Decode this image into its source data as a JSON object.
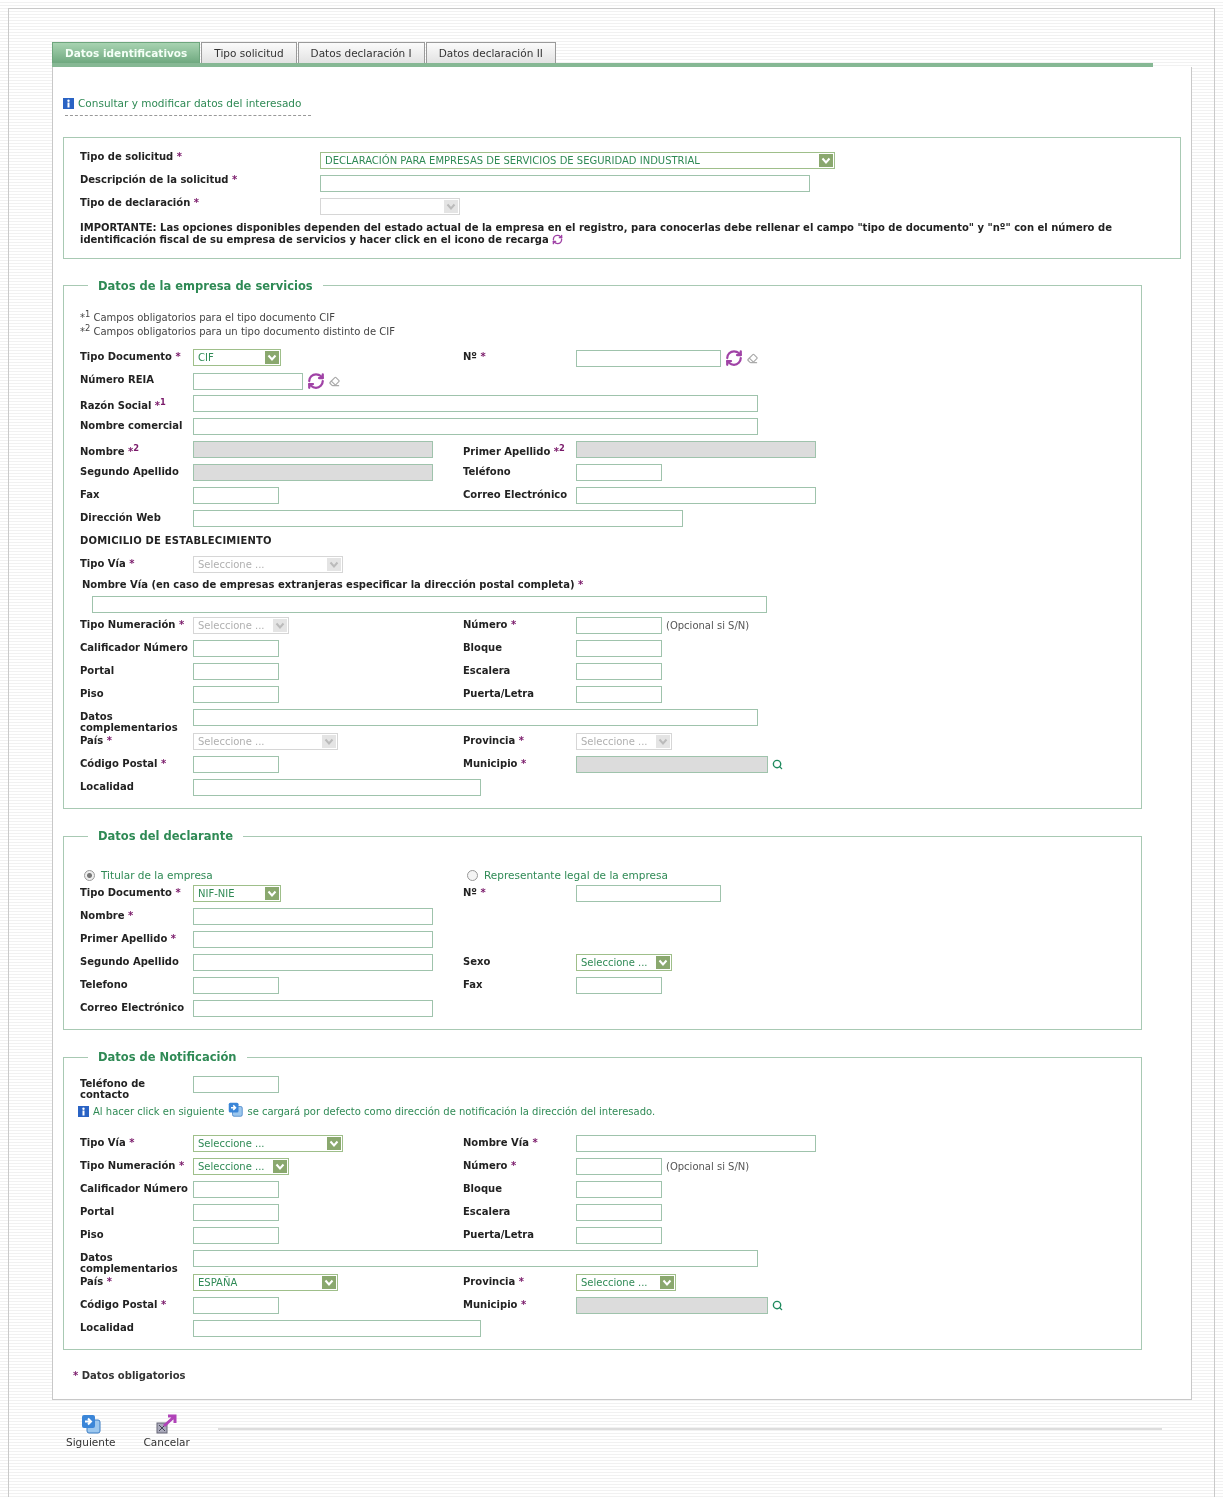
{
  "tabs": [
    {
      "label": "Datos identificativos",
      "selected": true
    },
    {
      "label": "Tipo solicitud",
      "selected": false
    },
    {
      "label": "Datos declaración I",
      "selected": false
    },
    {
      "label": "Datos declaración II",
      "selected": false
    }
  ],
  "info_link": "Consultar y modificar datos del interesado",
  "request": {
    "fields": [
      {
        "label": "Tipo de solicitud",
        "mark": "*",
        "control": {
          "kind": "select",
          "value": "DECLARACIÓN PARA EMPRESAS DE SERVICIOS DE SEGURIDAD INDUSTRIAL",
          "disabled": false
        }
      },
      {
        "label": "Descripción de la solicitud",
        "mark": "*",
        "control": {
          "kind": "text"
        }
      },
      {
        "label": "Tipo de declaración",
        "mark": "*",
        "control": {
          "kind": "select",
          "disabled": true
        }
      }
    ],
    "note": "IMPORTANTE: Las opciones disponibles dependen del estado actual de la empresa en el registro, para conocerlas debe rellenar el campo \"tipo de documento\" y \"nº\" con el número de identificación fiscal de su empresa de servicios y hacer click en el icono de recarga"
  },
  "sections": [
    {
      "title": "Datos de la empresa de servicios",
      "notes": [
        "*$^{1}$ Campos obligatorios para el tipo documento CIF",
        "*$^{2}$ Campos obligatorios para un tipo documento distinto de CIF"
      ],
      "rows": [
        {
          "kind": "pair",
          "left": {
            "label": "Tipo Documento",
            "mark": "*",
            "control": {
              "kind": "select",
              "value": "CIF",
              "disabled": false
            }
          },
          "right": {
            "label": "Nº",
            "mark": "*",
            "control": {
              "kind": "text"
            },
            "extras": [
              {
                "kind": "refresh"
              },
              {
                "kind": "eraser"
              }
            ]
          }
        },
        {
          "kind": "pair",
          "left": {
            "label": "Número REIA",
            "control": {
              "kind": "text"
            },
            "extras": [
              {
                "kind": "refresh"
              },
              {
                "kind": "eraser"
              }
            ]
          }
        },
        {
          "kind": "pair",
          "left": {
            "label": "Razón Social",
            "mark": "*$^{1}$",
            "control": {
              "kind": "text"
            }
          }
        },
        {
          "kind": "pair",
          "left": {
            "label": "Nombre comercial",
            "control": {
              "kind": "text"
            }
          }
        },
        {
          "kind": "pair",
          "left": {
            "label": "Nombre",
            "mark": "*$^{2}$",
            "control": {
              "kind": "readonly"
            }
          },
          "right": {
            "label": "Primer Apellido",
            "mark": "*$^{2}$",
            "control": {
              "kind": "readonly"
            }
          }
        },
        {
          "kind": "pair",
          "left": {
            "label": "Segundo Apellido",
            "control": {
              "kind": "readonly"
            }
          },
          "right": {
            "label": "Teléfono",
            "control": {
              "kind": "text"
            }
          }
        },
        {
          "kind": "pair",
          "left": {
            "label": "Fax",
            "control": {
              "kind": "text"
            }
          },
          "right": {
            "label": "Correo Electrónico",
            "control": {
              "kind": "text"
            }
          }
        },
        {
          "kind": "pair",
          "left": {
            "label": "Dirección Web",
            "control": {
              "kind": "text"
            }
          }
        },
        {
          "kind": "heading",
          "text": "DOMICILIO DE ESTABLECIMIENTO"
        },
        {
          "kind": "pair",
          "left": {
            "label": "Tipo Vía",
            "mark": "*",
            "control": {
              "kind": "select",
              "value": "Seleccione ...",
              "disabled": true
            }
          }
        },
        {
          "kind": "wide_label",
          "label": "Nombre Vía (en caso de empresas extranjeras especificar la dirección postal completa)",
          "mark": "*"
        },
        {
          "kind": "wide_input",
          "control": {
            "kind": "text"
          }
        },
        {
          "kind": "pair",
          "left": {
            "label": "Tipo Numeración",
            "mark": "*",
            "control": {
              "kind": "select",
              "value": "Seleccione ...",
              "disabled": true
            }
          },
          "right": {
            "label": "Número",
            "mark": "*",
            "control": {
              "kind": "text"
            },
            "extras": [
              {
                "kind": "hint",
                "text": "(Opcional si S/N)"
              }
            ]
          }
        },
        {
          "kind": "pair",
          "left": {
            "label": "Calificador Número",
            "control": {
              "kind": "text"
            }
          },
          "right": {
            "label": "Bloque",
            "control": {
              "kind": "text"
            }
          }
        },
        {
          "kind": "pair",
          "left": {
            "label": "Portal",
            "control": {
              "kind": "text"
            }
          },
          "right": {
            "label": "Escalera",
            "control": {
              "kind": "text"
            }
          }
        },
        {
          "kind": "pair",
          "left": {
            "label": "Piso",
            "control": {
              "kind": "text"
            }
          },
          "right": {
            "label": "Puerta/Letra",
            "control": {
              "kind": "text"
            }
          }
        },
        {
          "kind": "pair",
          "left": {
            "label": "Datos complementarios",
            "control": {
              "kind": "text"
            }
          }
        },
        {
          "kind": "pair",
          "left": {
            "label": "País",
            "mark": "*",
            "control": {
              "kind": "select",
              "value": "Seleccione ...",
              "disabled": true
            }
          },
          "right": {
            "label": "Provincia",
            "mark": "*",
            "control": {
              "kind": "select",
              "value": "Seleccione ...",
              "disabled": true
            }
          }
        },
        {
          "kind": "pair",
          "left": {
            "label": "Código Postal",
            "mark": "*",
            "control": {
              "kind": "text"
            }
          },
          "right": {
            "label": "Municipio",
            "mark": "*",
            "control": {
              "kind": "readonly"
            },
            "extras": [
              {
                "kind": "search"
              }
            ]
          }
        },
        {
          "kind": "pair",
          "left": {
            "label": "Localidad",
            "control": {
              "kind": "text"
            }
          }
        }
      ]
    },
    {
      "title": "Datos del declarante",
      "rows": [
        {
          "kind": "radios",
          "options": [
            {
              "label": "Titular de la empresa",
              "selected": true
            },
            {
              "label": "Representante legal de la empresa",
              "selected": false
            }
          ]
        },
        {
          "kind": "pair",
          "left": {
            "label": "Tipo Documento",
            "mark": "*",
            "control": {
              "kind": "select",
              "value": "NIF-NIE",
              "disabled": false
            }
          },
          "right": {
            "label": "Nº",
            "mark": "*",
            "control": {
              "kind": "text"
            }
          }
        },
        {
          "kind": "pair",
          "left": {
            "label": "Nombre",
            "mark": "*",
            "control": {
              "kind": "text"
            }
          }
        },
        {
          "kind": "pair",
          "left": {
            "label": "Primer Apellido",
            "mark": "*",
            "control": {
              "kind": "text"
            }
          }
        },
        {
          "kind": "pair",
          "left": {
            "label": "Segundo Apellido",
            "control": {
              "kind": "text"
            }
          },
          "right": {
            "label": "Sexo",
            "control": {
              "kind": "select",
              "value": "Seleccione ...",
              "disabled": false
            }
          }
        },
        {
          "kind": "pair",
          "left": {
            "label": "Telefono",
            "control": {
              "kind": "text"
            }
          },
          "right": {
            "label": "Fax",
            "control": {
              "kind": "text"
            }
          }
        },
        {
          "kind": "pair",
          "left": {
            "label": "Correo Electrónico",
            "control": {
              "kind": "text"
            }
          }
        }
      ]
    },
    {
      "title": "Datos de Notificación",
      "rows": [
        {
          "kind": "pair",
          "left": {
            "label": "Teléfono de contacto",
            "control": {
              "kind": "text"
            }
          }
        },
        {
          "kind": "info",
          "before": "Al hacer click en siguiente",
          "after": "se cargará por defecto como dirección de notificación la dirección del interesado."
        },
        {
          "kind": "pair",
          "left": {
            "label": "Tipo Vía",
            "mark": "*",
            "control": {
              "kind": "select",
              "value": "Seleccione ...",
              "disabled": false
            }
          },
          "right": {
            "label": "Nombre Vía",
            "mark": "*",
            "control": {
              "kind": "text"
            }
          }
        },
        {
          "kind": "pair",
          "left": {
            "label": "Tipo Numeración",
            "mark": "*",
            "control": {
              "kind": "select",
              "value": "Seleccione ...",
              "disabled": false
            }
          },
          "right": {
            "label": "Número",
            "mark": "*",
            "control": {
              "kind": "text"
            },
            "extras": [
              {
                "kind": "hint",
                "text": "(Opcional si S/N)"
              }
            ]
          }
        },
        {
          "kind": "pair",
          "left": {
            "label": "Calificador Número",
            "control": {
              "kind": "text"
            }
          },
          "right": {
            "label": "Bloque",
            "control": {
              "kind": "text"
            }
          }
        },
        {
          "kind": "pair",
          "left": {
            "label": "Portal",
            "control": {
              "kind": "text"
            }
          },
          "right": {
            "label": "Escalera",
            "control": {
              "kind": "text"
            }
          }
        },
        {
          "kind": "pair",
          "left": {
            "label": "Piso",
            "control": {
              "kind": "text"
            }
          },
          "right": {
            "label": "Puerta/Letra",
            "control": {
              "kind": "text"
            }
          }
        },
        {
          "kind": "pair",
          "left": {
            "label": "Datos complementarios",
            "control": {
              "kind": "text"
            }
          }
        },
        {
          "kind": "pair",
          "left": {
            "label": "País",
            "mark": "*",
            "control": {
              "kind": "select",
              "value": "ESPAÑA",
              "disabled": false
            }
          },
          "right": {
            "label": "Provincia",
            "mark": "*",
            "control": {
              "kind": "select",
              "value": "Seleccione ...",
              "disabled": false
            }
          }
        },
        {
          "kind": "pair",
          "left": {
            "label": "Código Postal",
            "mark": "*",
            "control": {
              "kind": "text"
            }
          },
          "right": {
            "label": "Municipio",
            "mark": "*",
            "control": {
              "kind": "readonly"
            },
            "extras": [
              {
                "kind": "search"
              }
            ]
          }
        },
        {
          "kind": "pair",
          "left": {
            "label": "Localidad",
            "control": {
              "kind": "text"
            }
          }
        }
      ]
    }
  ],
  "required_legend": {
    "mark": "*",
    "text": "Datos obligatorios"
  },
  "actions": [
    {
      "kind": "next",
      "label": "Siguiente"
    },
    {
      "kind": "cancel",
      "label": "Cancelar"
    }
  ]
}
